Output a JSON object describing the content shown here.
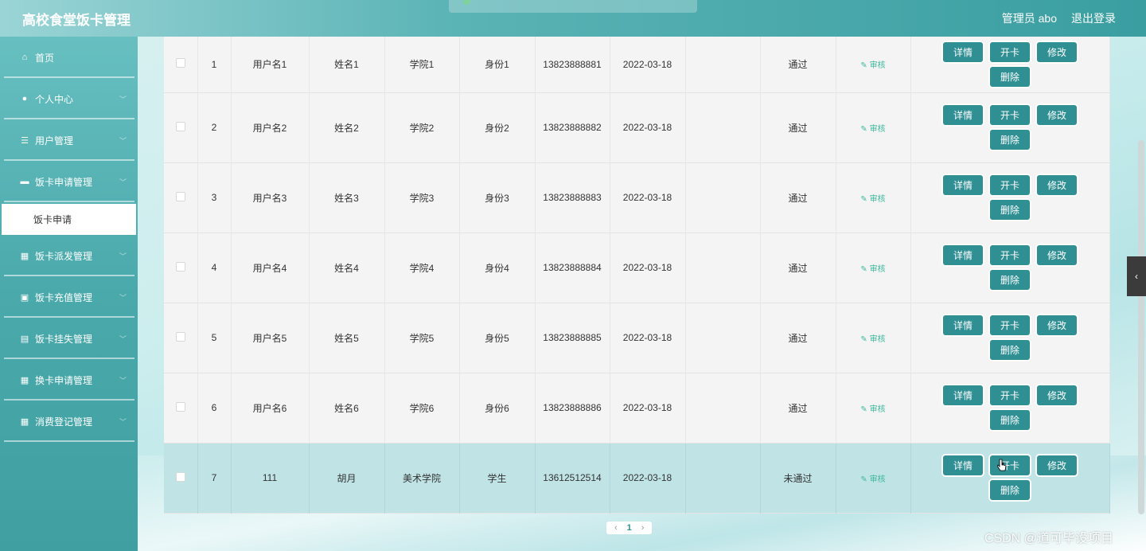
{
  "header": {
    "title": "高校食堂饭卡管理",
    "user": "管理员 abo",
    "logout": "退出登录"
  },
  "sidebar": {
    "items": [
      {
        "label": "首页",
        "icon": "home-icon",
        "glyph": "⌂"
      },
      {
        "label": "个人中心",
        "icon": "user-icon",
        "glyph": "●"
      },
      {
        "label": "用户管理",
        "icon": "sliders-icon",
        "glyph": "☰"
      },
      {
        "label": "饭卡申请管理",
        "icon": "ticket-icon",
        "glyph": "▬"
      },
      {
        "label": "饭卡派发管理",
        "icon": "grid-icon",
        "glyph": "▦"
      },
      {
        "label": "饭卡充值管理",
        "icon": "clipboard-icon",
        "glyph": "▣"
      },
      {
        "label": "饭卡挂失管理",
        "icon": "briefcase-icon",
        "glyph": "▤"
      },
      {
        "label": "换卡申请管理",
        "icon": "grid-icon",
        "glyph": "▦"
      },
      {
        "label": "消费登记管理",
        "icon": "grid-icon",
        "glyph": "▦"
      }
    ],
    "active_sub": "饭卡申请"
  },
  "table": {
    "rows": [
      {
        "idx": "1",
        "username": "用户名1",
        "name": "姓名1",
        "college": "学院1",
        "identity": "身份1",
        "phone": "13823888881",
        "date": "2022-03-18",
        "extra": "",
        "status": "通过"
      },
      {
        "idx": "2",
        "username": "用户名2",
        "name": "姓名2",
        "college": "学院2",
        "identity": "身份2",
        "phone": "13823888882",
        "date": "2022-03-18",
        "extra": "",
        "status": "通过"
      },
      {
        "idx": "3",
        "username": "用户名3",
        "name": "姓名3",
        "college": "学院3",
        "identity": "身份3",
        "phone": "13823888883",
        "date": "2022-03-18",
        "extra": "",
        "status": "通过"
      },
      {
        "idx": "4",
        "username": "用户名4",
        "name": "姓名4",
        "college": "学院4",
        "identity": "身份4",
        "phone": "13823888884",
        "date": "2022-03-18",
        "extra": "",
        "status": "通过"
      },
      {
        "idx": "5",
        "username": "用户名5",
        "name": "姓名5",
        "college": "学院5",
        "identity": "身份5",
        "phone": "13823888885",
        "date": "2022-03-18",
        "extra": "",
        "status": "通过"
      },
      {
        "idx": "6",
        "username": "用户名6",
        "name": "姓名6",
        "college": "学院6",
        "identity": "身份6",
        "phone": "13823888886",
        "date": "2022-03-18",
        "extra": "",
        "status": "通过"
      },
      {
        "idx": "7",
        "username": "111",
        "name": "胡月",
        "college": "美术学院",
        "identity": "学生",
        "phone": "13612512514",
        "date": "2022-03-18",
        "extra": "",
        "status": "未通过"
      }
    ],
    "audit_label": "审核",
    "buttons": {
      "detail": "详情",
      "open": "开卡",
      "edit": "修改",
      "delete": "删除"
    }
  },
  "pagination": {
    "prev": "‹",
    "current": "1",
    "next": "›"
  },
  "collapse_glyph": "‹",
  "watermark": "CSDN @道可毕设项目",
  "colors": {
    "accent": "#2f8f93",
    "sidebar": "#4aa9ab",
    "audit": "#3fb89e",
    "highlight_row": "#c0e3e5"
  }
}
